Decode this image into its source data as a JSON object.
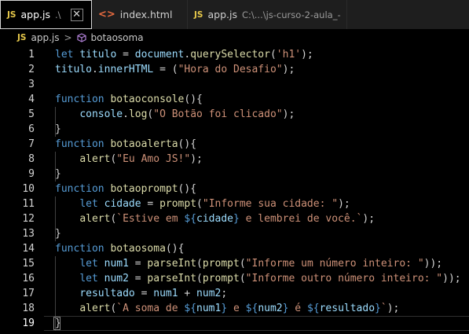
{
  "tabs": [
    {
      "badge": "JS",
      "name": "app.js",
      "desc": ".\\",
      "active": true,
      "close": "✕"
    },
    {
      "badge": "<>",
      "name": "index.html",
      "desc": "",
      "active": false
    },
    {
      "badge": "JS",
      "name": "app.js",
      "desc": "C:\\...\\js-curso-2-aula_-",
      "active": false
    }
  ],
  "breadcrumb": {
    "file_badge": "JS",
    "file": "app.js",
    "separator": ">",
    "symbol": "botaosoma"
  },
  "editor": {
    "current_line": 19,
    "lines": [
      {
        "n": "1",
        "tokens": [
          [
            "kw",
            "let "
          ],
          [
            "var",
            "titulo"
          ],
          [
            "plain",
            " = "
          ],
          [
            "var",
            "document"
          ],
          [
            "plain",
            "."
          ],
          [
            "fn",
            "querySelector"
          ],
          [
            "plain",
            "("
          ],
          [
            "str",
            "'h1'"
          ],
          [
            "plain",
            ");"
          ]
        ]
      },
      {
        "n": "2",
        "tokens": [
          [
            "var",
            "titulo"
          ],
          [
            "plain",
            "."
          ],
          [
            "var",
            "innerHTML"
          ],
          [
            "plain",
            " = ("
          ],
          [
            "str",
            "\"Hora do Desafio\""
          ],
          [
            "plain",
            ");"
          ]
        ]
      },
      {
        "n": "3",
        "tokens": []
      },
      {
        "n": "4",
        "tokens": [
          [
            "kw",
            "function "
          ],
          [
            "fn",
            "botaoconsole"
          ],
          [
            "plain",
            "(){"
          ]
        ]
      },
      {
        "n": "5",
        "tokens": [
          [
            "plain",
            "    "
          ],
          [
            "var",
            "console"
          ],
          [
            "plain",
            "."
          ],
          [
            "fn",
            "log"
          ],
          [
            "plain",
            "("
          ],
          [
            "str",
            "\"O Botão foi clicado\""
          ],
          [
            "plain",
            ");"
          ]
        ]
      },
      {
        "n": "6",
        "tokens": [
          [
            "plain",
            "}"
          ]
        ]
      },
      {
        "n": "7",
        "tokens": [
          [
            "kw",
            "function "
          ],
          [
            "fn",
            "botaoalerta"
          ],
          [
            "plain",
            "(){"
          ]
        ]
      },
      {
        "n": "8",
        "tokens": [
          [
            "plain",
            "    "
          ],
          [
            "fn",
            "alert"
          ],
          [
            "plain",
            "("
          ],
          [
            "str",
            "\"Eu Amo JS!\""
          ],
          [
            "plain",
            ");"
          ]
        ]
      },
      {
        "n": "9",
        "tokens": [
          [
            "plain",
            "}"
          ]
        ]
      },
      {
        "n": "10",
        "tokens": [
          [
            "kw",
            "function "
          ],
          [
            "fn",
            "botaoprompt"
          ],
          [
            "plain",
            "(){"
          ]
        ]
      },
      {
        "n": "11",
        "tokens": [
          [
            "plain",
            "    "
          ],
          [
            "kw",
            "let "
          ],
          [
            "var",
            "cidade"
          ],
          [
            "plain",
            " = "
          ],
          [
            "fn",
            "prompt"
          ],
          [
            "plain",
            "("
          ],
          [
            "str",
            "\"Informe sua cidade: \""
          ],
          [
            "plain",
            ");"
          ]
        ]
      },
      {
        "n": "12",
        "tokens": [
          [
            "plain",
            "    "
          ],
          [
            "fn",
            "alert"
          ],
          [
            "plain",
            "("
          ],
          [
            "str",
            "`Estive em "
          ],
          [
            "kw",
            "${"
          ],
          [
            "var",
            "cidade"
          ],
          [
            "kw",
            "}"
          ],
          [
            "str",
            " e lembrei de você.`"
          ],
          [
            "plain",
            ");"
          ]
        ]
      },
      {
        "n": "13",
        "tokens": [
          [
            "plain",
            "}"
          ]
        ]
      },
      {
        "n": "14",
        "tokens": [
          [
            "kw",
            "function "
          ],
          [
            "fn",
            "botaosoma"
          ],
          [
            "plain",
            "()"
          ],
          [
            "plain",
            "{"
          ]
        ]
      },
      {
        "n": "15",
        "tokens": [
          [
            "plain",
            "    "
          ],
          [
            "kw",
            "let "
          ],
          [
            "var",
            "num1"
          ],
          [
            "plain",
            " = "
          ],
          [
            "fn",
            "parseInt"
          ],
          [
            "plain",
            "("
          ],
          [
            "fn",
            "prompt"
          ],
          [
            "plain",
            "("
          ],
          [
            "str",
            "\"Informe um número inteiro: \""
          ],
          [
            "plain",
            "));"
          ]
        ]
      },
      {
        "n": "16",
        "tokens": [
          [
            "plain",
            "    "
          ],
          [
            "kw",
            "let "
          ],
          [
            "var",
            "num2"
          ],
          [
            "plain",
            " = "
          ],
          [
            "fn",
            "parseInt"
          ],
          [
            "plain",
            "("
          ],
          [
            "fn",
            "prompt"
          ],
          [
            "plain",
            "("
          ],
          [
            "str",
            "\"Informe outro número inteiro: \""
          ],
          [
            "plain",
            "));"
          ]
        ]
      },
      {
        "n": "17",
        "tokens": [
          [
            "plain",
            "    "
          ],
          [
            "var",
            "resultado"
          ],
          [
            "plain",
            " = "
          ],
          [
            "var",
            "num1"
          ],
          [
            "plain",
            " + "
          ],
          [
            "var",
            "num2"
          ],
          [
            "plain",
            ";"
          ]
        ]
      },
      {
        "n": "18",
        "tokens": [
          [
            "plain",
            "    "
          ],
          [
            "fn",
            "alert"
          ],
          [
            "plain",
            "("
          ],
          [
            "str",
            "`A soma de "
          ],
          [
            "kw",
            "${"
          ],
          [
            "var",
            "num1"
          ],
          [
            "kw",
            "}"
          ],
          [
            "str",
            " e "
          ],
          [
            "kw",
            "${"
          ],
          [
            "var",
            "num2"
          ],
          [
            "kw",
            "}"
          ],
          [
            "str",
            " é "
          ],
          [
            "kw",
            "${"
          ],
          [
            "var",
            "resultado"
          ],
          [
            "kw",
            "}"
          ],
          [
            "str",
            "`"
          ],
          [
            "plain",
            ");"
          ]
        ]
      },
      {
        "n": "19",
        "tokens": [
          [
            "plain",
            "}"
          ]
        ]
      }
    ]
  },
  "colors": {
    "background": "#000000",
    "tabbar": "#1e1e1e",
    "keyword": "#569cd6",
    "function": "#dcdcaa",
    "string": "#ce9178",
    "variable": "#9cdcfe",
    "text": "#d4d4d4",
    "js_badge": "#e6c84a",
    "html_badge": "#e86b40"
  },
  "icons": {
    "js_file": "js-file-icon",
    "html_file": "html-file-icon",
    "symbol": "cube-method-icon",
    "close": "close-icon"
  }
}
